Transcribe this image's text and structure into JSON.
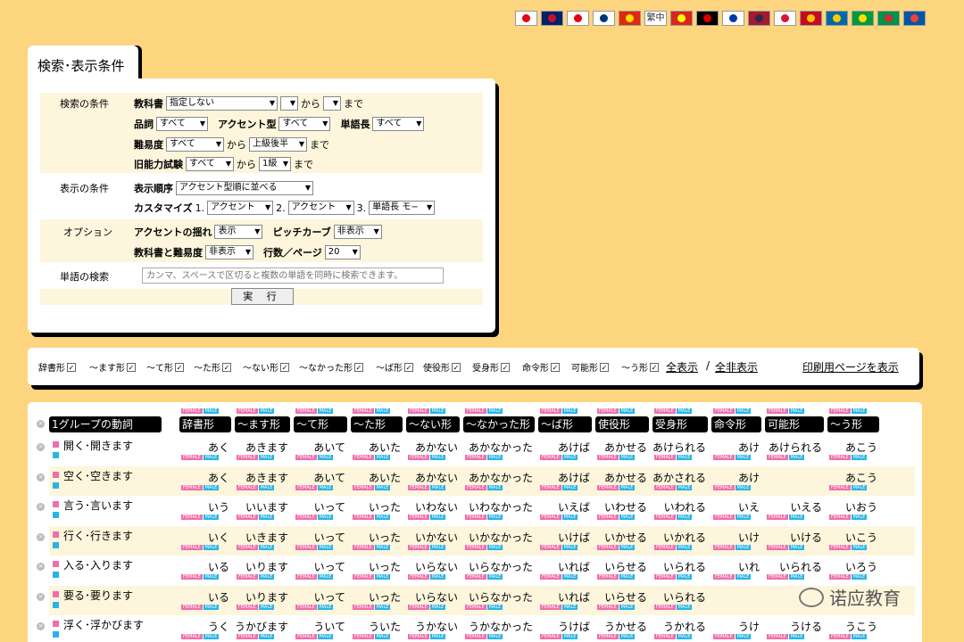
{
  "flags": [
    {
      "name": "japan-flag-icon",
      "bg": "#ffffff",
      "mark": "#e60012"
    },
    {
      "name": "uk-flag-icon",
      "bg": "#012169",
      "mark": "#c8102e"
    },
    {
      "name": "indonesia-flag-icon",
      "bg": "#ffffff",
      "mark": "#e70011"
    },
    {
      "name": "korea-flag-icon",
      "bg": "#ffffff",
      "mark": "#003478"
    },
    {
      "name": "china-flag-icon",
      "bg": "#de2910",
      "mark": "#ffde00"
    },
    {
      "name": "traditional-chinese-flag-icon",
      "bg": "#ffffff",
      "mark": "#333333",
      "text": "繁中"
    },
    {
      "name": "vietnam-flag-icon",
      "bg": "#da251d",
      "mark": "#ffff00"
    },
    {
      "name": "germany-flag-icon",
      "bg": "#000000",
      "mark": "#dd0000"
    },
    {
      "name": "russia-flag-icon",
      "bg": "#ffffff",
      "mark": "#0039a6"
    },
    {
      "name": "thailand-flag-icon",
      "bg": "#a51931",
      "mark": "#2d2a4a"
    },
    {
      "name": "poland-flag-icon",
      "bg": "#ffffff",
      "mark": "#dc143c"
    },
    {
      "name": "spain-flag-icon",
      "bg": "#c60b1e",
      "mark": "#ffc400"
    },
    {
      "name": "sweden-flag-icon",
      "bg": "#006aa7",
      "mark": "#fecc00"
    },
    {
      "name": "brazil-flag-icon",
      "bg": "#009c3b",
      "mark": "#ffdf00"
    },
    {
      "name": "italy-flag-icon",
      "bg": "#009246",
      "mark": "#ce2b37"
    },
    {
      "name": "france-flag-icon",
      "bg": "#0055a4",
      "mark": "#ef4135"
    }
  ],
  "search": {
    "tab_title": "検索･表示条件",
    "conditions_label": "検索の条件",
    "textbook_label": "教科書",
    "textbook_value": "指定しない",
    "from_text": "から",
    "to_text": "まで",
    "pos_label": "品詞",
    "pos_value": "すべて",
    "accent_label": "アクセント型",
    "accent_value": "すべて",
    "length_label": "単語長",
    "length_value": "すべて",
    "difficulty_label": "難易度",
    "difficulty_value": "すべて",
    "difficulty_to": "上級後半",
    "jlpt_label": "旧能力試験",
    "jlpt_value": "すべて",
    "jlpt_to": "1級",
    "display_label": "表示の条件",
    "order_label": "表示順序",
    "order_value": "アクセント型順に並べる",
    "customize_label": "カスタマイズ",
    "c1_num": "1.",
    "c1_value": "アクセント",
    "c2_num": "2.",
    "c2_value": "アクセント",
    "c3_num": "3.",
    "c3_value": "単語長 モ−",
    "option_label": "オプション",
    "sway_label": "アクセントの揺れ",
    "sway_value": "表示",
    "pitch_label": "ピッチカーブ",
    "pitch_value": "非表示",
    "tbdiff_label": "教科書と難易度",
    "tbdiff_value": "非表示",
    "rows_label": "行数／ページ",
    "rows_value": "20",
    "word_search_label": "単語の検索",
    "word_search_placeholder": "カンマ、スペースで区切ると複数の単語を同時に検索できます。",
    "run_button": "実 行"
  },
  "filters": {
    "items": [
      "辞書形",
      "〜ます形",
      "〜て形",
      "〜た形",
      "〜ない形",
      "〜なかった形",
      "〜ば形",
      "使役形",
      "受身形",
      "命令形",
      "可能形",
      "〜う形"
    ],
    "show_all": "全表示",
    "separator": "/",
    "hide_all": "全非表示",
    "print": "印刷用ページを表示"
  },
  "table": {
    "tag_female": "FEMALE",
    "tag_male": "MALE",
    "headers": [
      "1グループの動詞",
      "辞書形",
      "〜ます形",
      "〜て形",
      "〜た形",
      "〜ない形",
      "〜なかった形",
      "〜ば形",
      "使役形",
      "受身形",
      "命令形",
      "可能形",
      "〜う形"
    ],
    "rows": [
      {
        "word": "開く･開きます",
        "cells": [
          "あく",
          "あきます",
          "あいて",
          "あいた",
          "あかない",
          "あかなかった",
          "あけば",
          "あかせる",
          "あけられる",
          "あけ",
          "あけられる",
          "あこう"
        ]
      },
      {
        "word": "空く･空きます",
        "cells": [
          "あく",
          "あきます",
          "あいて",
          "あいた",
          "あかない",
          "あかなかった",
          "あけば",
          "あかせる",
          "あかされる",
          "あけ",
          "",
          "あこう"
        ]
      },
      {
        "word": "言う･言います",
        "cells": [
          "いう",
          "いいます",
          "いって",
          "いった",
          "いわない",
          "いわなかった",
          "いえば",
          "いわせる",
          "いわれる",
          "いえ",
          "いえる",
          "いおう"
        ]
      },
      {
        "word": "行く･行きます",
        "cells": [
          "いく",
          "いきます",
          "いって",
          "いった",
          "いかない",
          "いかなかった",
          "いけば",
          "いかせる",
          "いかれる",
          "いけ",
          "いける",
          "いこう"
        ]
      },
      {
        "word": "入る･入ります",
        "cells": [
          "いる",
          "いります",
          "いって",
          "いった",
          "いらない",
          "いらなかった",
          "いれば",
          "いらせる",
          "いられる",
          "いれ",
          "いられる",
          "いろう"
        ]
      },
      {
        "word": "要る･要ります",
        "cells": [
          "いる",
          "いります",
          "いって",
          "いった",
          "いらない",
          "いらなかった",
          "いれば",
          "いらせる",
          "いられる",
          "",
          "",
          ""
        ]
      },
      {
        "word": "浮く･浮かびます",
        "cells": [
          "うく",
          "うかびます",
          "ういて",
          "ういた",
          "うかない",
          "うかなかった",
          "うけば",
          "うかせる",
          "うかれる",
          "うけ",
          "うける",
          "うこう"
        ]
      }
    ]
  },
  "watermark": "诺应教育"
}
